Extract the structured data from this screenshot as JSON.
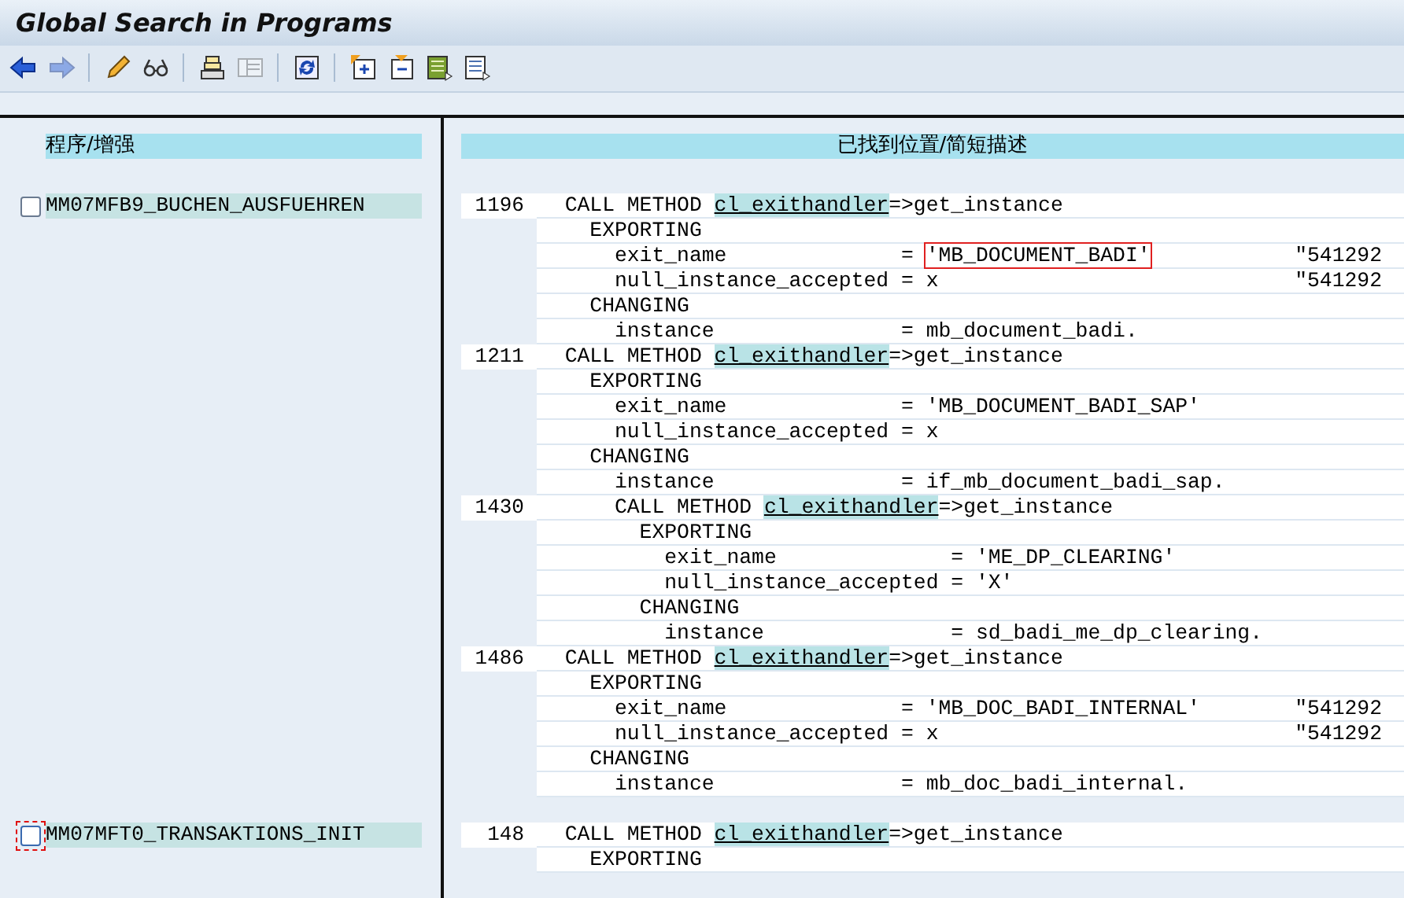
{
  "window": {
    "title": "Global Search in Programs"
  },
  "toolbar": [
    {
      "kind": "back",
      "disabled": false
    },
    {
      "kind": "forward",
      "disabled": true
    },
    {
      "kind": "separator"
    },
    {
      "kind": "pencil",
      "disabled": false
    },
    {
      "kind": "glasses",
      "disabled": false
    },
    {
      "kind": "separator"
    },
    {
      "kind": "stack",
      "disabled": false
    },
    {
      "kind": "table",
      "disabled": true
    },
    {
      "kind": "separator"
    },
    {
      "kind": "refresh",
      "disabled": false
    },
    {
      "kind": "separator"
    },
    {
      "kind": "expand",
      "disabled": false
    },
    {
      "kind": "collapse",
      "disabled": false
    },
    {
      "kind": "list-green",
      "disabled": false
    },
    {
      "kind": "list-blue",
      "disabled": false
    }
  ],
  "columns": [
    "程序/增强",
    "已找到位置/简短描述"
  ],
  "results": [
    {
      "program": "MM07MFB9_BUCHEN_AUSFUEHREN",
      "checked": false,
      "focused": false,
      "lines": [
        {
          "number": "1196",
          "parts": [
            {
              "kind": "plain",
              "text": "  CALL METHOD "
            },
            {
              "kind": "match",
              "text": "cl_exithandler"
            },
            {
              "kind": "plain",
              "text": "=>get_instance"
            }
          ]
        },
        {
          "parts": [
            {
              "kind": "plain",
              "text": "    EXPORTING"
            }
          ]
        },
        {
          "parts": [
            {
              "kind": "plain",
              "text": "      exit_name              = "
            },
            {
              "kind": "boxed",
              "text": "'MB_DOCUMENT_BADI'"
            }
          ],
          "comment": "\"541292"
        },
        {
          "parts": [
            {
              "kind": "plain",
              "text": "      null_instance_accepted = x"
            }
          ],
          "comment": "\"541292"
        },
        {
          "parts": [
            {
              "kind": "plain",
              "text": "    CHANGING"
            }
          ]
        },
        {
          "parts": [
            {
              "kind": "plain",
              "text": "      instance               = mb_document_badi."
            }
          ]
        },
        {
          "number": "1211",
          "parts": [
            {
              "kind": "plain",
              "text": "  CALL METHOD "
            },
            {
              "kind": "match",
              "text": "cl_exithandler"
            },
            {
              "kind": "plain",
              "text": "=>get_instance"
            }
          ]
        },
        {
          "parts": [
            {
              "kind": "plain",
              "text": "    EXPORTING"
            }
          ]
        },
        {
          "parts": [
            {
              "kind": "plain",
              "text": "      exit_name              = 'MB_DOCUMENT_BADI_SAP'"
            }
          ]
        },
        {
          "parts": [
            {
              "kind": "plain",
              "text": "      null_instance_accepted = x"
            }
          ]
        },
        {
          "parts": [
            {
              "kind": "plain",
              "text": "    CHANGING"
            }
          ]
        },
        {
          "parts": [
            {
              "kind": "plain",
              "text": "      instance               = if_mb_document_badi_sap."
            }
          ]
        },
        {
          "number": "1430",
          "parts": [
            {
              "kind": "plain",
              "text": "      CALL METHOD "
            },
            {
              "kind": "match",
              "text": "cl_exithandler"
            },
            {
              "kind": "plain",
              "text": "=>get_instance"
            }
          ]
        },
        {
          "parts": [
            {
              "kind": "plain",
              "text": "        EXPORTING"
            }
          ]
        },
        {
          "parts": [
            {
              "kind": "plain",
              "text": "          exit_name              = 'ME_DP_CLEARING'"
            }
          ]
        },
        {
          "parts": [
            {
              "kind": "plain",
              "text": "          null_instance_accepted = 'X'"
            }
          ]
        },
        {
          "parts": [
            {
              "kind": "plain",
              "text": "        CHANGING"
            }
          ]
        },
        {
          "parts": [
            {
              "kind": "plain",
              "text": "          instance               = sd_badi_me_dp_clearing."
            }
          ]
        },
        {
          "number": "1486",
          "parts": [
            {
              "kind": "plain",
              "text": "  CALL METHOD "
            },
            {
              "kind": "match",
              "text": "cl_exithandler"
            },
            {
              "kind": "plain",
              "text": "=>get_instance"
            }
          ]
        },
        {
          "parts": [
            {
              "kind": "plain",
              "text": "    EXPORTING"
            }
          ]
        },
        {
          "parts": [
            {
              "kind": "plain",
              "text": "      exit_name              = 'MB_DOC_BADI_INTERNAL'"
            }
          ],
          "comment": "\"541292"
        },
        {
          "parts": [
            {
              "kind": "plain",
              "text": "      null_instance_accepted = x"
            }
          ],
          "comment": "\"541292"
        },
        {
          "parts": [
            {
              "kind": "plain",
              "text": "    CHANGING"
            }
          ]
        },
        {
          "parts": [
            {
              "kind": "plain",
              "text": "      instance               = mb_doc_badi_internal."
            }
          ]
        }
      ]
    },
    {
      "program": "MM07MFT0_TRANSAKTIONS_INIT",
      "checked": false,
      "focused": true,
      "lines": [
        {
          "number": "148",
          "parts": [
            {
              "kind": "plain",
              "text": "  CALL METHOD "
            },
            {
              "kind": "match",
              "text": "cl_exithandler"
            },
            {
              "kind": "plain",
              "text": "=>get_instance"
            }
          ]
        },
        {
          "parts": [
            {
              "kind": "plain",
              "text": "    EXPORTING"
            }
          ]
        }
      ]
    }
  ]
}
